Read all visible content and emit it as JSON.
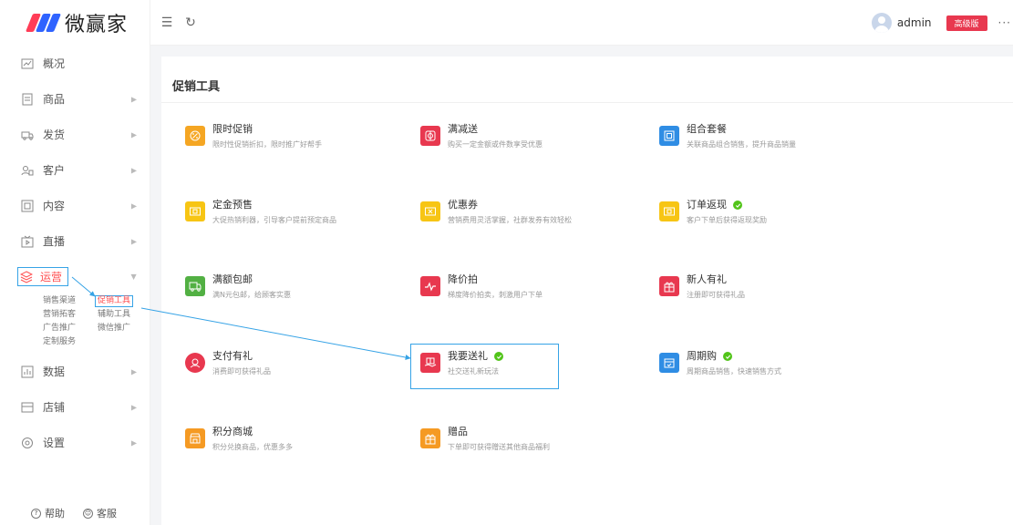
{
  "brand": {
    "name": "微赢家"
  },
  "header": {
    "username": "admin",
    "plan_badge": "高级版",
    "more": "···"
  },
  "sidebar": {
    "items": [
      {
        "label": "概况",
        "icon": "chart-icon"
      },
      {
        "label": "商品",
        "icon": "product-icon"
      },
      {
        "label": "发货",
        "icon": "delivery-icon"
      },
      {
        "label": "客户",
        "icon": "customer-icon"
      },
      {
        "label": "内容",
        "icon": "content-icon"
      },
      {
        "label": "直播",
        "icon": "live-icon"
      },
      {
        "label": "运营",
        "icon": "operation-icon"
      },
      {
        "label": "数据",
        "icon": "data-icon"
      },
      {
        "label": "店铺",
        "icon": "store-icon"
      },
      {
        "label": "设置",
        "icon": "settings-icon"
      }
    ],
    "submenu": [
      {
        "label": "销售渠道"
      },
      {
        "label": "促销工具"
      },
      {
        "label": "营销拓客"
      },
      {
        "label": "辅助工具"
      },
      {
        "label": "广告推广"
      },
      {
        "label": "微信推广"
      },
      {
        "label": "定制服务"
      }
    ],
    "footer": {
      "help": "帮助",
      "service": "客服"
    }
  },
  "main": {
    "title": "促销工具",
    "tools": [
      {
        "name": "限时促销",
        "desc": "限时性促销折扣，限时推广好帮手",
        "color": "#f5a623",
        "icon": "discount-icon"
      },
      {
        "name": "满减送",
        "desc": "购买一定金额或件数享受优惠",
        "color": "#e8384f",
        "icon": "gift-box-icon"
      },
      {
        "name": "组合套餐",
        "desc": "关联商品组合销售，提升商品销量",
        "color": "#2f8de4",
        "icon": "bundle-icon"
      },
      {
        "name": "定金预售",
        "desc": "大促热销利器，引导客户提前预定商品",
        "color": "#f7c514",
        "icon": "presale-icon"
      },
      {
        "name": "优惠券",
        "desc": "营销费用灵活掌握，社群发券有效轻松",
        "color": "#f7c514",
        "icon": "coupon-icon"
      },
      {
        "name": "订单返现",
        "desc": "客户下单后获得返现奖励",
        "color": "#f7c514",
        "icon": "cashback-icon"
      },
      {
        "name": "满额包邮",
        "desc": "满N元包邮，给顾客实惠",
        "color": "#52b043",
        "icon": "truck-icon"
      },
      {
        "name": "降价拍",
        "desc": "梯度降价拍卖，刺激用户下单",
        "color": "#e8384f",
        "icon": "price-drop-icon"
      },
      {
        "name": "新人有礼",
        "desc": "注册即可获得礼品",
        "color": "#e8384f",
        "icon": "present-icon"
      },
      {
        "name": "支付有礼",
        "desc": "消费即可获得礼品",
        "color": "#e8384f",
        "icon": "pay-gift-icon"
      },
      {
        "name": "我要送礼",
        "desc": "社交送礼新玩法",
        "color": "#e8384f",
        "icon": "send-gift-icon"
      },
      {
        "name": "周期购",
        "desc": "周期商品销售，快速销售方式",
        "color": "#2f8de4",
        "icon": "calendar-icon"
      },
      {
        "name": "积分商城",
        "desc": "积分兑换商品，优惠多多",
        "color": "#f59a23",
        "icon": "points-store-icon"
      },
      {
        "name": "赠品",
        "desc": "下单即可获得赠送其他商品福利",
        "color": "#f59a23",
        "icon": "freebie-icon"
      }
    ]
  },
  "colors": {
    "accent": "#ff4d4f",
    "highlight": "#36a3e6",
    "check": "#52c41a"
  }
}
